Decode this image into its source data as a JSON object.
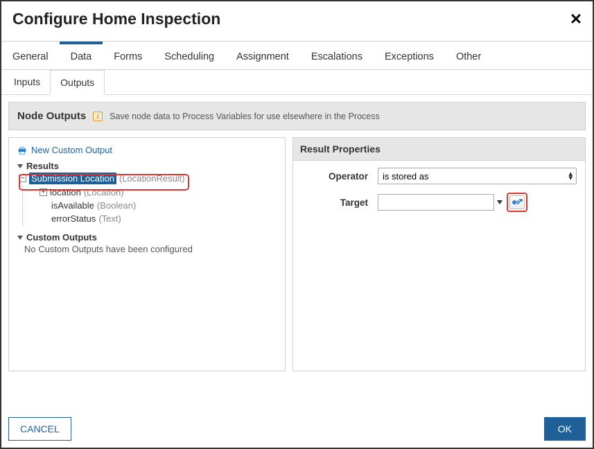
{
  "dialog": {
    "title": "Configure Home Inspection",
    "close_label": "✕"
  },
  "tabs_primary": [
    {
      "label": "General",
      "active": false
    },
    {
      "label": "Data",
      "active": true
    },
    {
      "label": "Forms",
      "active": false
    },
    {
      "label": "Scheduling",
      "active": false
    },
    {
      "label": "Assignment",
      "active": false
    },
    {
      "label": "Escalations",
      "active": false
    },
    {
      "label": "Exceptions",
      "active": false
    },
    {
      "label": "Other",
      "active": false
    }
  ],
  "tabs_secondary": [
    {
      "label": "Inputs",
      "active": false
    },
    {
      "label": "Outputs",
      "active": true
    }
  ],
  "section": {
    "title": "Node Outputs",
    "hint": "Save node data to Process Variables for use elsewhere in the Process"
  },
  "left_panel": {
    "new_output_label": "New Custom Output",
    "results_label": "Results",
    "tree": {
      "root": {
        "name": "Submission Location",
        "type": "(LocationResult)",
        "selected": true
      },
      "children": [
        {
          "name": "location",
          "type": "(Location)",
          "expandable": true
        },
        {
          "name": "isAvailable",
          "type": "(Boolean)",
          "expandable": false
        },
        {
          "name": "errorStatus",
          "type": "(Text)",
          "expandable": false
        }
      ]
    },
    "custom_outputs_label": "Custom Outputs",
    "custom_outputs_empty": "No Custom Outputs have been configured"
  },
  "right_panel": {
    "title": "Result Properties",
    "operator_label": "Operator",
    "operator_value": "is stored as",
    "target_label": "Target",
    "target_value": ""
  },
  "footer": {
    "cancel_label": "CANCEL",
    "ok_label": "OK"
  }
}
